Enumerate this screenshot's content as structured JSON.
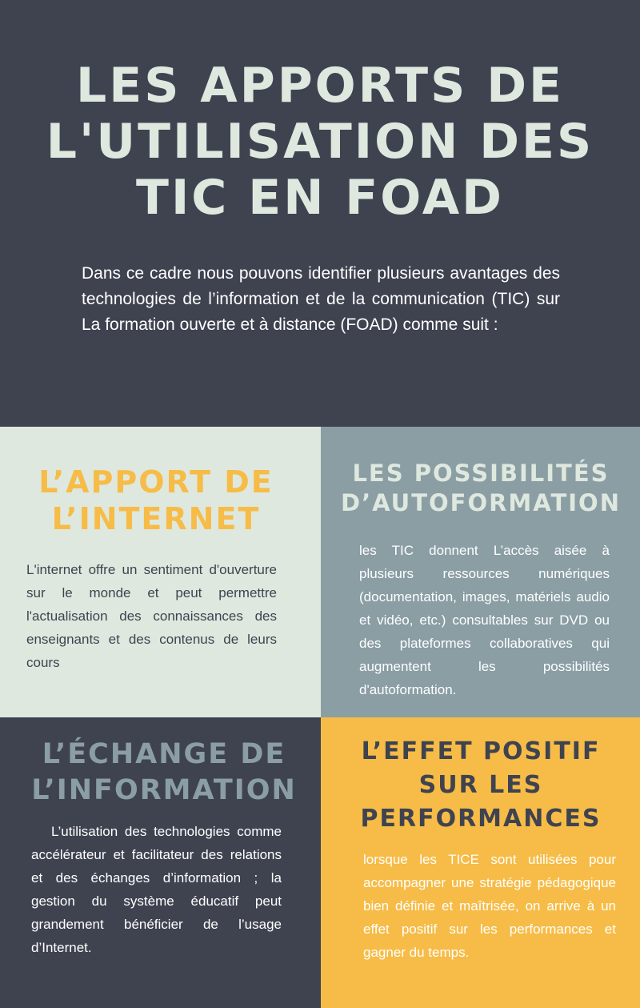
{
  "header": {
    "title": "Les apports de l'utilisation des TIC en FOAD",
    "intro": "Dans ce cadre nous pouvons identifier plusieurs avantages des technologies de l’information et de la communication (TIC) sur La formation ouverte et à distance (FOAD) comme suit :"
  },
  "panels": [
    {
      "title": "L’apport de l’internet",
      "body": "L'internet offre un sentiment d'ouverture sur le monde et peut permettre l'actualisation des connaissances des enseignants et des contenus de leurs cours"
    },
    {
      "title": "Les possibilités d’autoformation",
      "body": "les TIC donnent L’accès aisée à plusieurs ressources numériques (documentation, images, matériels audio et vidéo, etc.) consultables sur DVD ou des plateformes collaboratives qui augmentent les possibilités d'autoformation."
    },
    {
      "title": "L’échange de l’information",
      "body": "L’utilisation des technologies comme accélérateur et facilitateur des relations et des échanges d’information ; la gestion du système éducatif peut grandement bénéficier de l’usage d’Internet."
    },
    {
      "title": "L’effet positif sur les performances",
      "body": "lorsque les TICE sont utilisées pour accompagner une stratégie pédagogique bien définie et maîtrisée, on arrive à un effet positif sur les performances et gagner du temps."
    }
  ],
  "colors": {
    "dark": "#3f4350",
    "mint": "#dfe8df",
    "slate": "#8a9ea4",
    "yellow": "#f6bc47"
  }
}
